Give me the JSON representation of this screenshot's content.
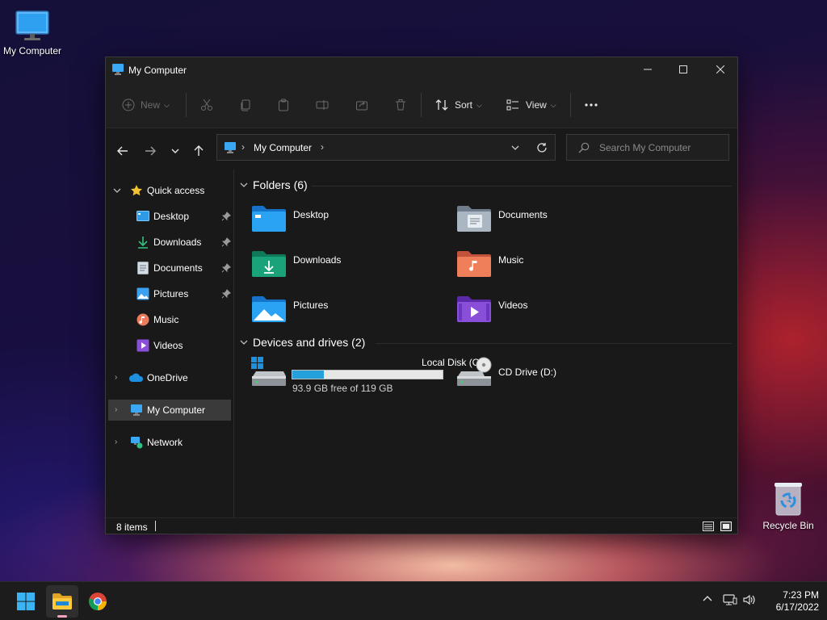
{
  "desktop": {
    "icons": [
      {
        "label": "My Computer"
      },
      {
        "label": "Recycle Bin"
      }
    ]
  },
  "window": {
    "title": "My Computer",
    "toolbar": {
      "new_label": "New",
      "sort_label": "Sort",
      "view_label": "View"
    },
    "address": {
      "crumb": "My Computer"
    },
    "search": {
      "placeholder": "Search My Computer"
    },
    "sidebar": {
      "quick_access": "Quick access",
      "items": [
        {
          "label": "Desktop",
          "pinned": true
        },
        {
          "label": "Downloads",
          "pinned": true
        },
        {
          "label": "Documents",
          "pinned": true
        },
        {
          "label": "Pictures",
          "pinned": true
        },
        {
          "label": "Music",
          "pinned": false
        },
        {
          "label": "Videos",
          "pinned": false
        }
      ],
      "onedrive": "OneDrive",
      "my_computer": "My Computer",
      "network": "Network"
    },
    "content": {
      "folders_header": "Folders (6)",
      "folders": [
        {
          "name": "Desktop",
          "icon": "desktop-folder-icon"
        },
        {
          "name": "Documents",
          "icon": "documents-folder-icon"
        },
        {
          "name": "Downloads",
          "icon": "downloads-folder-icon"
        },
        {
          "name": "Music",
          "icon": "music-folder-icon"
        },
        {
          "name": "Pictures",
          "icon": "pictures-folder-icon"
        },
        {
          "name": "Videos",
          "icon": "videos-folder-icon"
        }
      ],
      "drives_header": "Devices and drives (2)",
      "drives": [
        {
          "name": "Local Disk (C:)",
          "free_text": "93.9 GB free of 119 GB",
          "used_fraction": 0.21
        },
        {
          "name": "CD Drive (D:)"
        }
      ]
    },
    "status": {
      "item_count": "8 items"
    }
  },
  "taskbar": {
    "time": "7:23 PM",
    "date": "6/17/2022"
  },
  "colors": {
    "accent": "#26a0da",
    "folder_blue": "#1e90e0",
    "folder_green": "#1aa37a",
    "folder_orange": "#ef7f5a",
    "folder_purple": "#8a4fd8"
  }
}
